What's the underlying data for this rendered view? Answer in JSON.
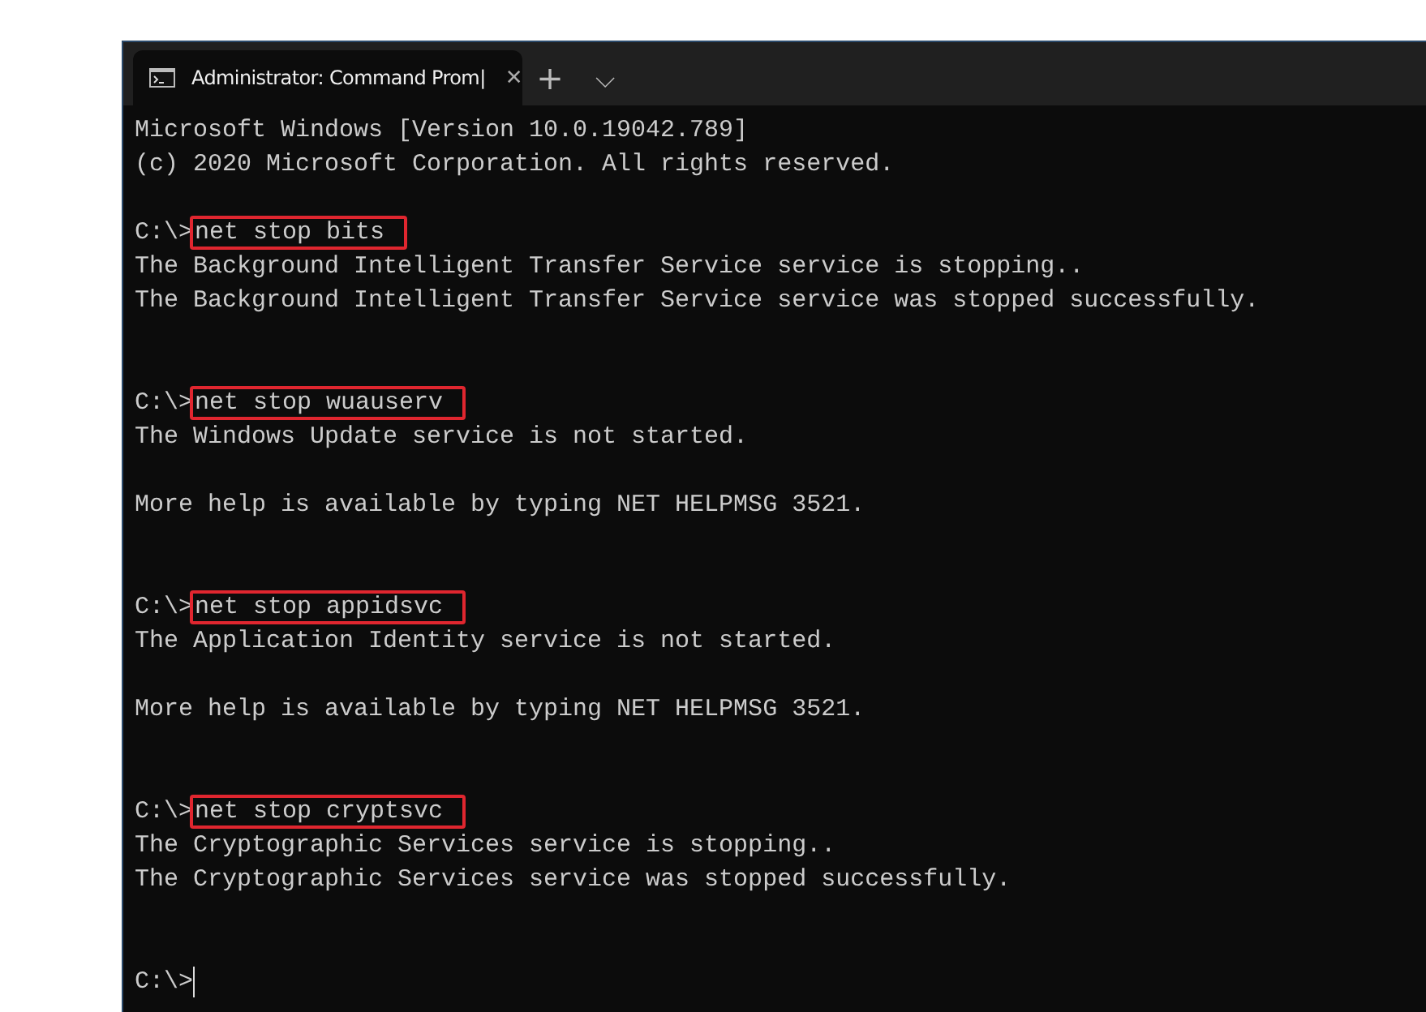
{
  "window": {
    "tab": {
      "title": "Administrator: Command Prom|",
      "close": "✕",
      "selected": true
    },
    "new_tab": "+",
    "dropdown": "⌵"
  },
  "console": {
    "lines": [
      {
        "kind": "text",
        "text": "Microsoft Windows [Version 10.0.19042.789]"
      },
      {
        "kind": "text",
        "text": "(c) 2020 Microsoft Corporation. All rights reserved."
      },
      {
        "kind": "blank"
      },
      {
        "kind": "command",
        "prompt": "C:\\>",
        "command": "net stop bits",
        "highlighted": true
      },
      {
        "kind": "text",
        "text": "The Background Intelligent Transfer Service service is stopping.."
      },
      {
        "kind": "text",
        "text": "The Background Intelligent Transfer Service service was stopped successfully."
      },
      {
        "kind": "blank"
      },
      {
        "kind": "blank"
      },
      {
        "kind": "command",
        "prompt": "C:\\>",
        "command": "net stop wuauserv",
        "highlighted": true
      },
      {
        "kind": "text",
        "text": "The Windows Update service is not started."
      },
      {
        "kind": "blank"
      },
      {
        "kind": "text",
        "text": "More help is available by typing NET HELPMSG 3521."
      },
      {
        "kind": "blank"
      },
      {
        "kind": "blank"
      },
      {
        "kind": "command",
        "prompt": "C:\\>",
        "command": "net stop appidsvc",
        "highlighted": true
      },
      {
        "kind": "text",
        "text": "The Application Identity service is not started."
      },
      {
        "kind": "blank"
      },
      {
        "kind": "text",
        "text": "More help is available by typing NET HELPMSG 3521."
      },
      {
        "kind": "blank"
      },
      {
        "kind": "blank"
      },
      {
        "kind": "command",
        "prompt": "C:\\>",
        "command": "net stop cryptsvc",
        "highlighted": true
      },
      {
        "kind": "text",
        "text": "The Cryptographic Services service is stopping.."
      },
      {
        "kind": "text",
        "text": "The Cryptographic Services service was stopped successfully."
      },
      {
        "kind": "blank"
      },
      {
        "kind": "blank"
      },
      {
        "kind": "cursor",
        "prompt": "C:\\>"
      }
    ]
  }
}
